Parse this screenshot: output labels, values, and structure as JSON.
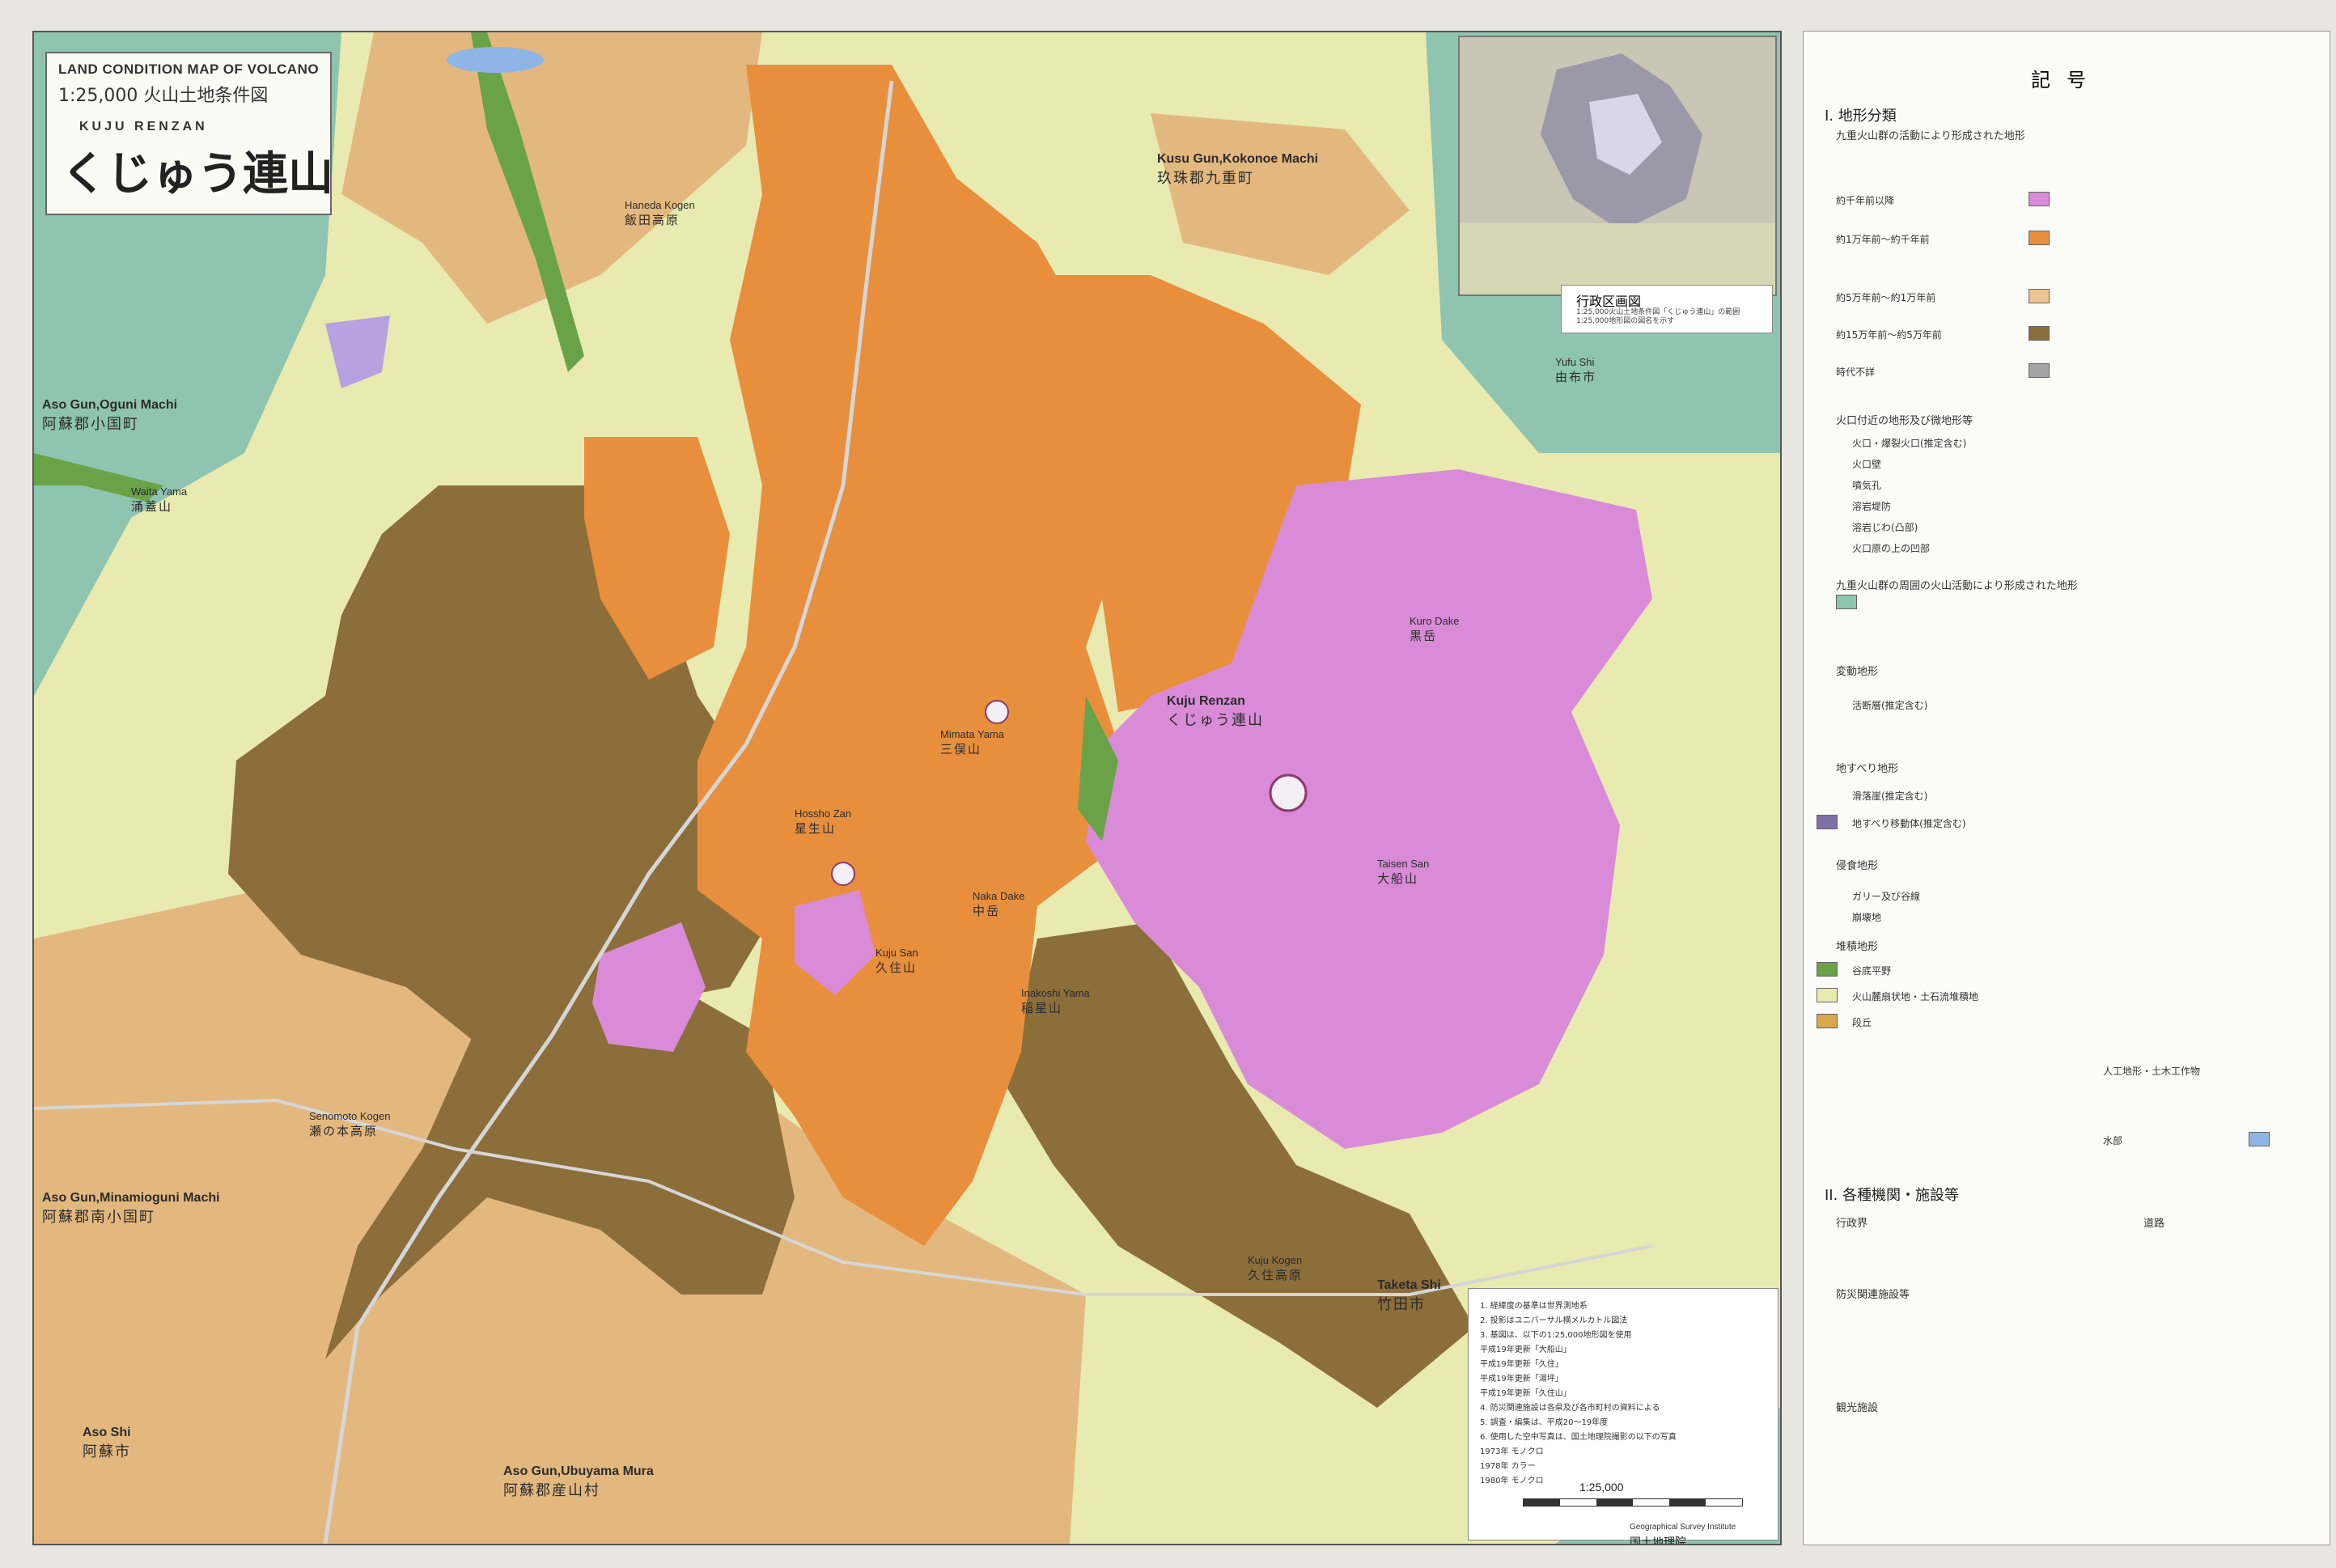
{
  "title": {
    "english": "LAND CONDITION MAP OF VOLCANO",
    "scale_japanese": "1:25,000  火山土地条件図",
    "romaji": "KUJU    RENZAN",
    "main": "くじゅう連山"
  },
  "inset": {
    "title": "行政区画図",
    "note": "1:25,000火山土地条件図「くじゅう連山」の範囲 1:25,000地形図の図名を示す"
  },
  "places": [
    {
      "key": "yufu",
      "r": "Yufu Shi",
      "j": "由布市"
    },
    {
      "key": "kokonoe",
      "r": "Kusu Gun,Kokonoe Machi",
      "j": "玖珠郡九重町"
    },
    {
      "key": "oguni",
      "r": "Aso Gun,Oguni Machi",
      "j": "阿蘇郡小国町"
    },
    {
      "key": "minamioguni",
      "r": "Aso Gun,Minamioguni Machi",
      "j": "阿蘇郡南小国町"
    },
    {
      "key": "aso",
      "r": "Aso Shi",
      "j": "阿蘇市"
    },
    {
      "key": "ubuyama",
      "r": "Aso Gun,Ubuyama Mura",
      "j": "阿蘇郡産山村"
    },
    {
      "key": "taketa",
      "r": "Taketa Shi",
      "j": "竹田市"
    },
    {
      "key": "kuju_renzan",
      "r": "Kuju Renzan",
      "j": "くじゅう連山"
    },
    {
      "key": "haneda",
      "r": "Haneda Kogen",
      "j": "飯田高原"
    },
    {
      "key": "senomoto",
      "r": "Senomoto Kogen",
      "j": "瀬の本高原"
    },
    {
      "key": "kuju_kogen",
      "r": "Kuju Kogen",
      "j": "久住高原"
    },
    {
      "key": "kuju_san",
      "r": "Kuju San",
      "j": "久住山"
    },
    {
      "key": "daisen",
      "r": "Taisen San",
      "j": "大船山"
    },
    {
      "key": "mimata",
      "r": "Mimata Yama",
      "j": "三俣山"
    },
    {
      "key": "hossho",
      "r": "Hossho Zan",
      "j": "星生山"
    },
    {
      "key": "waita",
      "r": "Waita Yama",
      "j": "涌蓋山"
    },
    {
      "key": "kurodake",
      "r": "Kuro Dake",
      "j": "黒岳"
    },
    {
      "key": "nakadake",
      "r": "Naka Dake",
      "j": "中岳"
    },
    {
      "key": "inakoshi",
      "r": "Inakoshi Yama",
      "j": "稲星山"
    }
  ],
  "notes": [
    "1. 経緯度の基準は世界測地系",
    "2. 投影はユニバーサル横メルカトル図法",
    "3. 基図は、以下の1:25,000地形図を使用",
    "   平成19年更新「大船山」",
    "   平成19年更新「久住」",
    "   平成19年更新「湯坪」",
    "   平成19年更新「久住山」",
    "4. 防災関連施設は各県及び各市町村の資料による",
    "5. 調査・編集は、平成20～19年度",
    "6. 使用した空中写真は、国土地理院撮影の以下の写真",
    "   1973年 モノクロ",
    "   1978年 カラー",
    "   1980年 モノクロ"
  ],
  "scale_label": "1:25,000",
  "publisher_en": "Geographical Survey Institute",
  "publisher_jp": "国土地理院",
  "legend": {
    "heading": "記号",
    "section1": "I. 地形分類",
    "sub1": "九重火山群の活動により形成された地形",
    "rows": [
      {
        "label": "約千年前以降",
        "color": "#d98bd8"
      },
      {
        "label": "約1万年前～約千年前",
        "color": "#e88f3e"
      },
      {
        "label": "約5万年前～約1万年前",
        "color": "#e9c392"
      },
      {
        "label": "約15万年前～約5万年前",
        "color": "#8c6e3a"
      },
      {
        "label": "時代不詳",
        "color": "#a4a4a4"
      }
    ],
    "crater_head": "火口付近の地形及び微地形等",
    "crater_items": [
      "火口・爆裂火口(推定含む)",
      "火口壁",
      "噴気孔",
      "溶岩堤防",
      "溶岩じわ(凸部)",
      "火口原の上の凹部"
    ],
    "other_volcano": "九重火山群の周囲の火山活動により形成された地形",
    "tectonic": "変動地形",
    "fault": "活断層(推定含む)",
    "landslide": "地すべり地形",
    "landslide_items": [
      "滑落崖(推定含む)",
      "地すべり移動体(推定含む)"
    ],
    "erosion": "侵食地形",
    "erosion_items": [
      "ガリー及び谷線",
      "崩壊地"
    ],
    "deposit": "堆積地形",
    "deposit_items": [
      {
        "label": "谷底平野",
        "color": "#6aa347"
      },
      {
        "label": "火山麓扇状地・土石流堆積地",
        "color": "#e8eab0"
      },
      {
        "label": "段丘",
        "color": "#d7a94a"
      }
    ],
    "artificial": "人工地形・土木工作物",
    "water": "水部",
    "section2": "II. 各種機関・施設等",
    "admin": "行政界",
    "road": "道路",
    "disaster": "防災関連施設等",
    "tourist": "観光施設"
  },
  "colors": {
    "recent": "#d98bd8",
    "holocene": "#e88f3e",
    "older": "#e9c392",
    "oldest": "#8c6e3a",
    "plain": "#e8eab0",
    "valley": "#6aa347",
    "other_volcanic": "#8fc5b0",
    "terrace": "#d7a94a"
  }
}
